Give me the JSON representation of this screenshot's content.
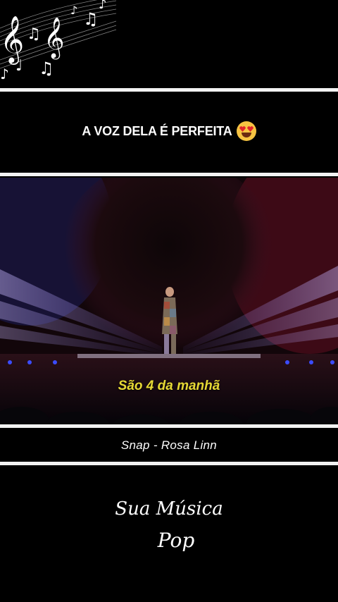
{
  "caption": {
    "text": "A VOZ DELA É PERFEITA",
    "emoji": "heart-eyes-emoji"
  },
  "video": {
    "subtitle": "São 4 da manhã"
  },
  "song": {
    "title": "Snap - Rosa Linn"
  },
  "logo": {
    "line1": "Sua Música",
    "line2": "Pop"
  },
  "colors": {
    "background": "#000000",
    "divider": "#f2f2f2",
    "subtitle": "#e6d835",
    "stage_red": "#3a0c18",
    "beam": "#b7a6ff"
  }
}
